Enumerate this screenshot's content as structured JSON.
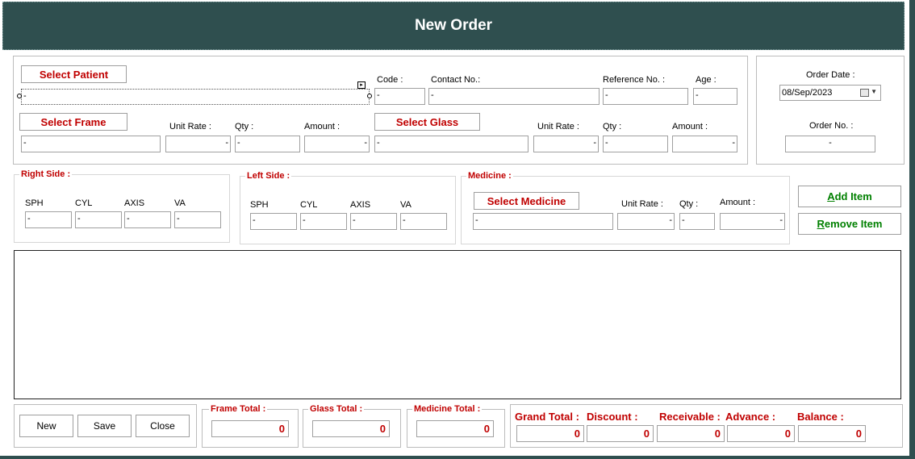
{
  "window": {
    "title": "New Order"
  },
  "patient": {
    "select_label": "Select Patient",
    "name_value": "-",
    "code_label": "Code :",
    "code_value": "-",
    "contact_label": "Contact No.:",
    "contact_value": "-",
    "reference_label": "Reference No. :",
    "reference_value": "-",
    "age_label": "Age :",
    "age_value": "-"
  },
  "frame": {
    "select_label": "Select Frame",
    "name_value": "-",
    "unit_rate_label": "Unit Rate :",
    "unit_rate_value": "-",
    "qty_label": "Qty :",
    "qty_value": "-",
    "amount_label": "Amount :",
    "amount_value": "-"
  },
  "glass": {
    "select_label": "Select Glass",
    "name_value": "-",
    "unit_rate_label": "Unit Rate :",
    "unit_rate_value": "-",
    "qty_label": "Qty :",
    "qty_value": "-",
    "amount_label": "Amount :",
    "amount_value": "-"
  },
  "order": {
    "date_label": "Order Date :",
    "date_value": "08/Sep/2023",
    "no_label": "Order No. :",
    "no_value": "-"
  },
  "right_side": {
    "title": "Right Side :",
    "sph_label": "SPH",
    "sph_value": "-",
    "cyl_label": "CYL",
    "cyl_value": "-",
    "axis_label": "AXIS",
    "axis_value": "-",
    "va_label": "VA",
    "va_value": "-"
  },
  "left_side": {
    "title": "Left Side :",
    "sph_label": "SPH",
    "sph_value": "-",
    "cyl_label": "CYL",
    "cyl_value": "-",
    "axis_label": "AXIS",
    "axis_value": "-",
    "va_label": "VA",
    "va_value": "-"
  },
  "medicine": {
    "title": "Medicine :",
    "select_label": "Select Medicine",
    "name_value": "-",
    "unit_rate_label": "Unit Rate :",
    "unit_rate_value": "-",
    "qty_label": "Qty :",
    "qty_value": "-",
    "amount_label": "Amount :",
    "amount_value": "-"
  },
  "items": {
    "add_first": "A",
    "add_rest": "dd Item",
    "remove_first": "R",
    "remove_rest": "emove Item"
  },
  "actions": {
    "new": "New",
    "save": "Save",
    "close": "Close"
  },
  "totals": {
    "frame_label": "Frame Total :",
    "frame_value": "0",
    "glass_label": "Glass Total :",
    "glass_value": "0",
    "medicine_label": "Medicine Total :",
    "medicine_value": "0",
    "grand_label": "Grand Total :",
    "grand_value": "0",
    "discount_label": "Discount :",
    "discount_value": "0",
    "receivable_label": "Receivable :",
    "receivable_value": "0",
    "advance_label": "Advance :",
    "advance_value": "0",
    "balance_label": "Balance :",
    "balance_value": "0"
  },
  "icons": {
    "calendar": "calendar-icon",
    "dropdown": "chevron-down-icon",
    "smart_tag": "smart-tag-icon"
  },
  "colors": {
    "title_bar": "#2f4f4f",
    "accent_red": "#c00000",
    "accent_green": "#008000"
  }
}
